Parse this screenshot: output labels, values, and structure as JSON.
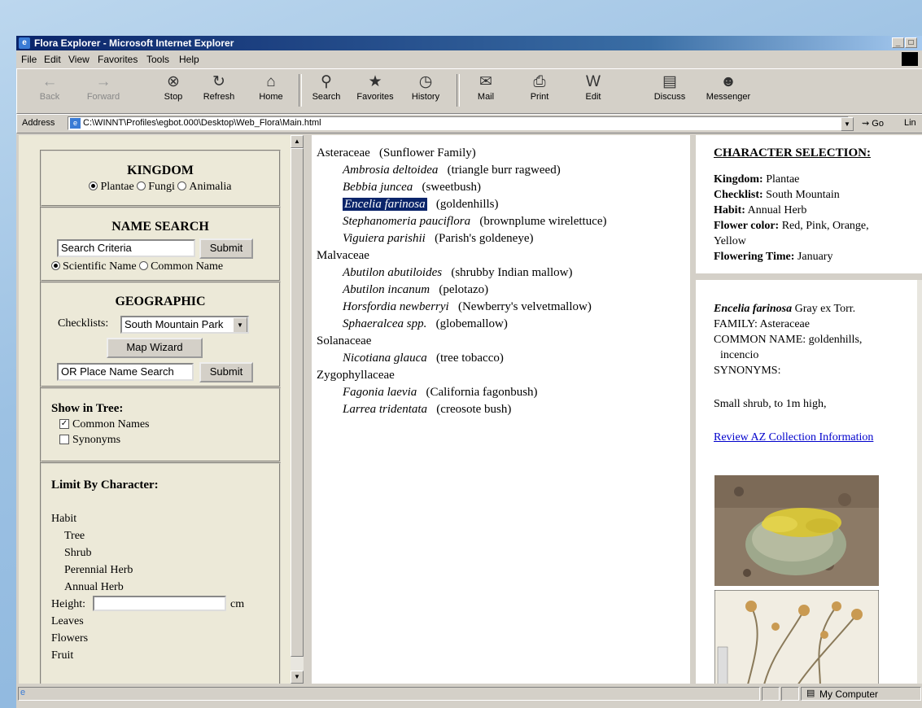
{
  "window": {
    "title": "Flora Explorer - Microsoft Internet Explorer"
  },
  "menu": [
    "File",
    "Edit",
    "View",
    "Favorites",
    "Tools",
    "Help"
  ],
  "toolbar": {
    "back": "Back",
    "forward": "Forward",
    "stop": "Stop",
    "refresh": "Refresh",
    "home": "Home",
    "search": "Search",
    "favorites": "Favorites",
    "history": "History",
    "mail": "Mail",
    "print": "Print",
    "edit": "Edit",
    "discuss": "Discuss",
    "messenger": "Messenger"
  },
  "address": {
    "label": "Address",
    "url": "C:\\WINNT\\Profiles\\egbot.000\\Desktop\\Web_Flora\\Main.html",
    "go": "Go",
    "links": "Lin"
  },
  "left": {
    "kingdom": {
      "heading": "KINGDOM",
      "options": [
        "Plantae",
        "Fungi",
        "Animalia"
      ],
      "selected": "Plantae"
    },
    "name_search": {
      "heading": "NAME SEARCH",
      "input_value": "Search Criteria",
      "submit": "Submit",
      "options": [
        "Scientific Name",
        "Common Name"
      ]
    },
    "geographic": {
      "heading": "GEOGRAPHIC",
      "checklists_label": "Checklists:",
      "checklist_value": "South Mountain Park",
      "map_wizard": "Map Wizard",
      "place_input": "OR Place Name Search",
      "submit": "Submit"
    },
    "show_tree": {
      "heading": "Show in Tree:",
      "common_names": "Common Names",
      "synonyms": "Synonyms"
    },
    "limit": {
      "heading": "Limit By Character:",
      "habit": "Habit",
      "habit_items": [
        "Tree",
        "Shrub",
        "Perennial Herb",
        "Annual Herb"
      ],
      "height_label": "Height:",
      "height_unit": "cm",
      "leaves": "Leaves",
      "flowers": "Flowers",
      "fruit": "Fruit"
    }
  },
  "tree": {
    "families": [
      {
        "name": "Asteraceae",
        "common": "(Sunflower Family)",
        "species": [
          {
            "sci": "Ambrosia deltoidea",
            "common": "(triangle burr ragweed)"
          },
          {
            "sci": "Bebbia juncea",
            "common": "(sweetbush)"
          },
          {
            "sci": "Encelia farinosa",
            "common": "(goldenhills)",
            "selected": true
          },
          {
            "sci": "Stephanomeria pauciflora",
            "common": "(brownplume wirelettuce)"
          },
          {
            "sci": "Viguiera parishii",
            "common": "(Parish's goldeneye)"
          }
        ]
      },
      {
        "name": "Malvaceae",
        "common": "",
        "species": [
          {
            "sci": "Abutilon abutiloides",
            "common": "(shrubby Indian mallow)"
          },
          {
            "sci": "Abutilon incanum",
            "common": "(pelotazo)"
          },
          {
            "sci": "Horsfordia newberryi",
            "common": "(Newberry's velvetmallow)"
          },
          {
            "sci": "Sphaeralcea spp.",
            "common": "(globemallow)"
          }
        ]
      },
      {
        "name": "Solanaceae",
        "common": "",
        "species": [
          {
            "sci": "Nicotiana glauca",
            "common": "(tree tobacco)"
          }
        ]
      },
      {
        "name": "Zygophyllaceae",
        "common": "",
        "species": [
          {
            "sci": "Fagonia laevia",
            "common": "(California fagonbush)"
          },
          {
            "sci": "Larrea tridentata",
            "common": "(creosote bush)"
          }
        ]
      }
    ]
  },
  "character_selection": {
    "heading": "CHARACTER SELECTION:",
    "kingdom_label": "Kingdom:",
    "kingdom": "Plantae",
    "checklist_label": "Checklist:",
    "checklist": "South Mountain",
    "habit_label": "Habit:",
    "habit": "Annual Herb",
    "flower_color_label": "Flower color:",
    "flower_color": "Red, Pink, Orange,",
    "flower_color_2": "Yellow",
    "flowering_label": "Flowering Time:",
    "flowering": "January"
  },
  "details": {
    "sci": "Encelia farinosa",
    "author": "Gray ex Torr.",
    "family": "FAMILY: Asteraceae",
    "common_1": "COMMON NAME: goldenhills,",
    "common_2": "incencio",
    "synonyms": "SYNONYMS:",
    "description": "Small shrub, to 1m high,",
    "link": "Review AZ Collection Information"
  },
  "status": {
    "zone": "My Computer"
  }
}
